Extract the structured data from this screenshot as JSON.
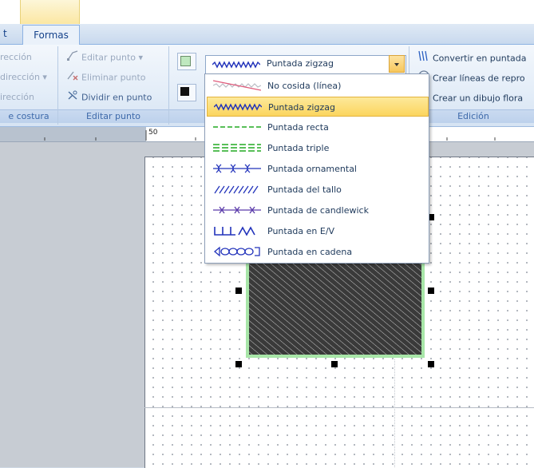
{
  "tabs": [
    {
      "label": "t"
    },
    {
      "label": "Formas",
      "active": true
    }
  ],
  "ribbon": {
    "group1": {
      "label": "e costura",
      "items": [
        {
          "label": "rección"
        },
        {
          "label": "dirección ▾"
        },
        {
          "label": "irección"
        }
      ]
    },
    "group2": {
      "label": "Editar punto",
      "items": [
        {
          "label": "Editar punto ▾",
          "enabled": false
        },
        {
          "label": "Eliminar punto",
          "enabled": false
        },
        {
          "label": "Dividir en punto",
          "enabled": true
        }
      ]
    },
    "group3": {
      "combo_value": "Puntada zigzag"
    },
    "group4": {
      "label": "Edición",
      "items": [
        {
          "label": "Convertir en puntada"
        },
        {
          "label": "Crear líneas de repro"
        },
        {
          "label": "Crear un dibujo flora"
        }
      ]
    }
  },
  "ruler": {
    "mark": "50"
  },
  "stitch_menu": {
    "items": [
      {
        "label": "No cosida (línea)",
        "icon": "no-stitch-icon"
      },
      {
        "label": "Puntada zigzag",
        "icon": "zigzag-stitch-icon",
        "selected": true
      },
      {
        "label": "Puntada recta",
        "icon": "straight-stitch-icon"
      },
      {
        "label": "Puntada triple",
        "icon": "triple-stitch-icon"
      },
      {
        "label": "Puntada ornamental",
        "icon": "ornamental-stitch-icon"
      },
      {
        "label": "Puntada del tallo",
        "icon": "stem-stitch-icon"
      },
      {
        "label": "Puntada de candlewick",
        "icon": "candlewick-stitch-icon"
      },
      {
        "label": "Puntada en E/V",
        "icon": "ev-stitch-icon"
      },
      {
        "label": "Puntada en cadena",
        "icon": "chain-stitch-icon"
      }
    ]
  },
  "colors": {
    "stitch_blue": "#2233bb",
    "stitch_green": "#22aa22",
    "no_stitch_red": "#e05a7a",
    "selection_yellow": "#fbd55e",
    "fill_green": "#9fe0a0"
  }
}
